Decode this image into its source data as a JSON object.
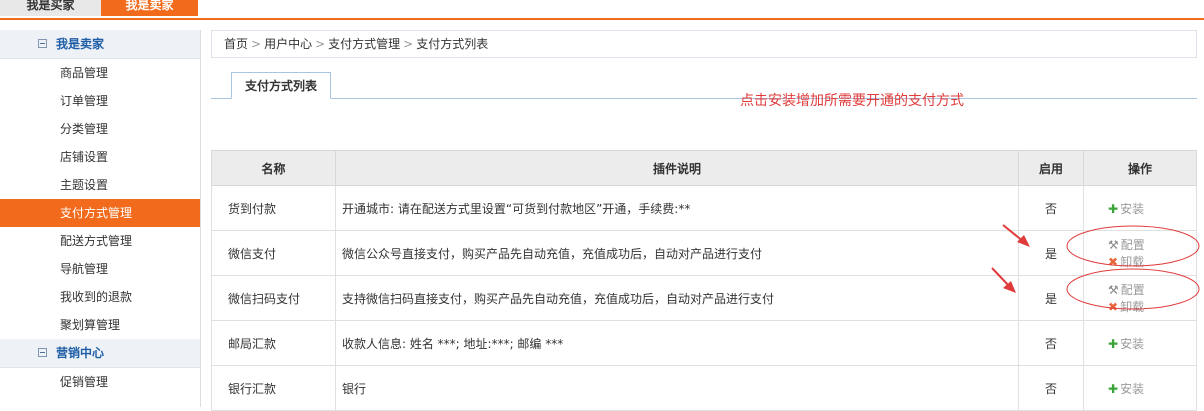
{
  "topnav": {
    "buyer_tab": "我是买家",
    "seller_tab": "我是卖家"
  },
  "sidebar": {
    "section1": "我是卖家",
    "items": [
      "商品管理",
      "订单管理",
      "分类管理",
      "店铺设置",
      "主题设置",
      "支付方式管理",
      "配送方式管理",
      "导航管理",
      "我收到的退款",
      "聚划算管理"
    ],
    "active_index": 5,
    "section2": "营销中心",
    "items2": [
      "促销管理"
    ]
  },
  "breadcrumb": [
    "首页",
    "用户中心",
    "支付方式管理",
    "支付方式列表"
  ],
  "breadcrumb_sep": ">",
  "tab": "支付方式列表",
  "annotation": "点击安装增加所需要开通的支付方式",
  "table": {
    "headers": [
      "名称",
      "插件说明",
      "启用",
      "操作"
    ],
    "rows": [
      {
        "name": "货到付款",
        "desc": "开通城市: 请在配送方式里设置“可货到付款地区”开通，手续费:**",
        "enabled": "否",
        "ops": [
          "安装"
        ]
      },
      {
        "name": "微信支付",
        "desc": "微信公众号直接支付，购买产品先自动充值，充值成功后，自动对产品进行支付",
        "enabled": "是",
        "ops": [
          "配置",
          "卸载"
        ]
      },
      {
        "name": "微信扫码支付",
        "desc": "支持微信扫码直接支付，购买产品先自动充值，充值成功后，自动对产品进行支付",
        "enabled": "是",
        "ops": [
          "配置",
          "卸载"
        ]
      },
      {
        "name": "邮局汇款",
        "desc": "收款人信息: 姓名 ***; 地址:***; 邮编 ***",
        "enabled": "否",
        "ops": [
          "安装"
        ]
      },
      {
        "name": "银行汇款",
        "desc": "银行",
        "enabled": "否",
        "ops": [
          "安装"
        ]
      }
    ]
  },
  "icons": {
    "install": "plus-icon",
    "config": "wrench-icon",
    "uninstall": "x-icon"
  },
  "colors": {
    "accent": "#f26a1b",
    "annotation": "#e03b3b",
    "link_blue": "#1f5fa8"
  }
}
